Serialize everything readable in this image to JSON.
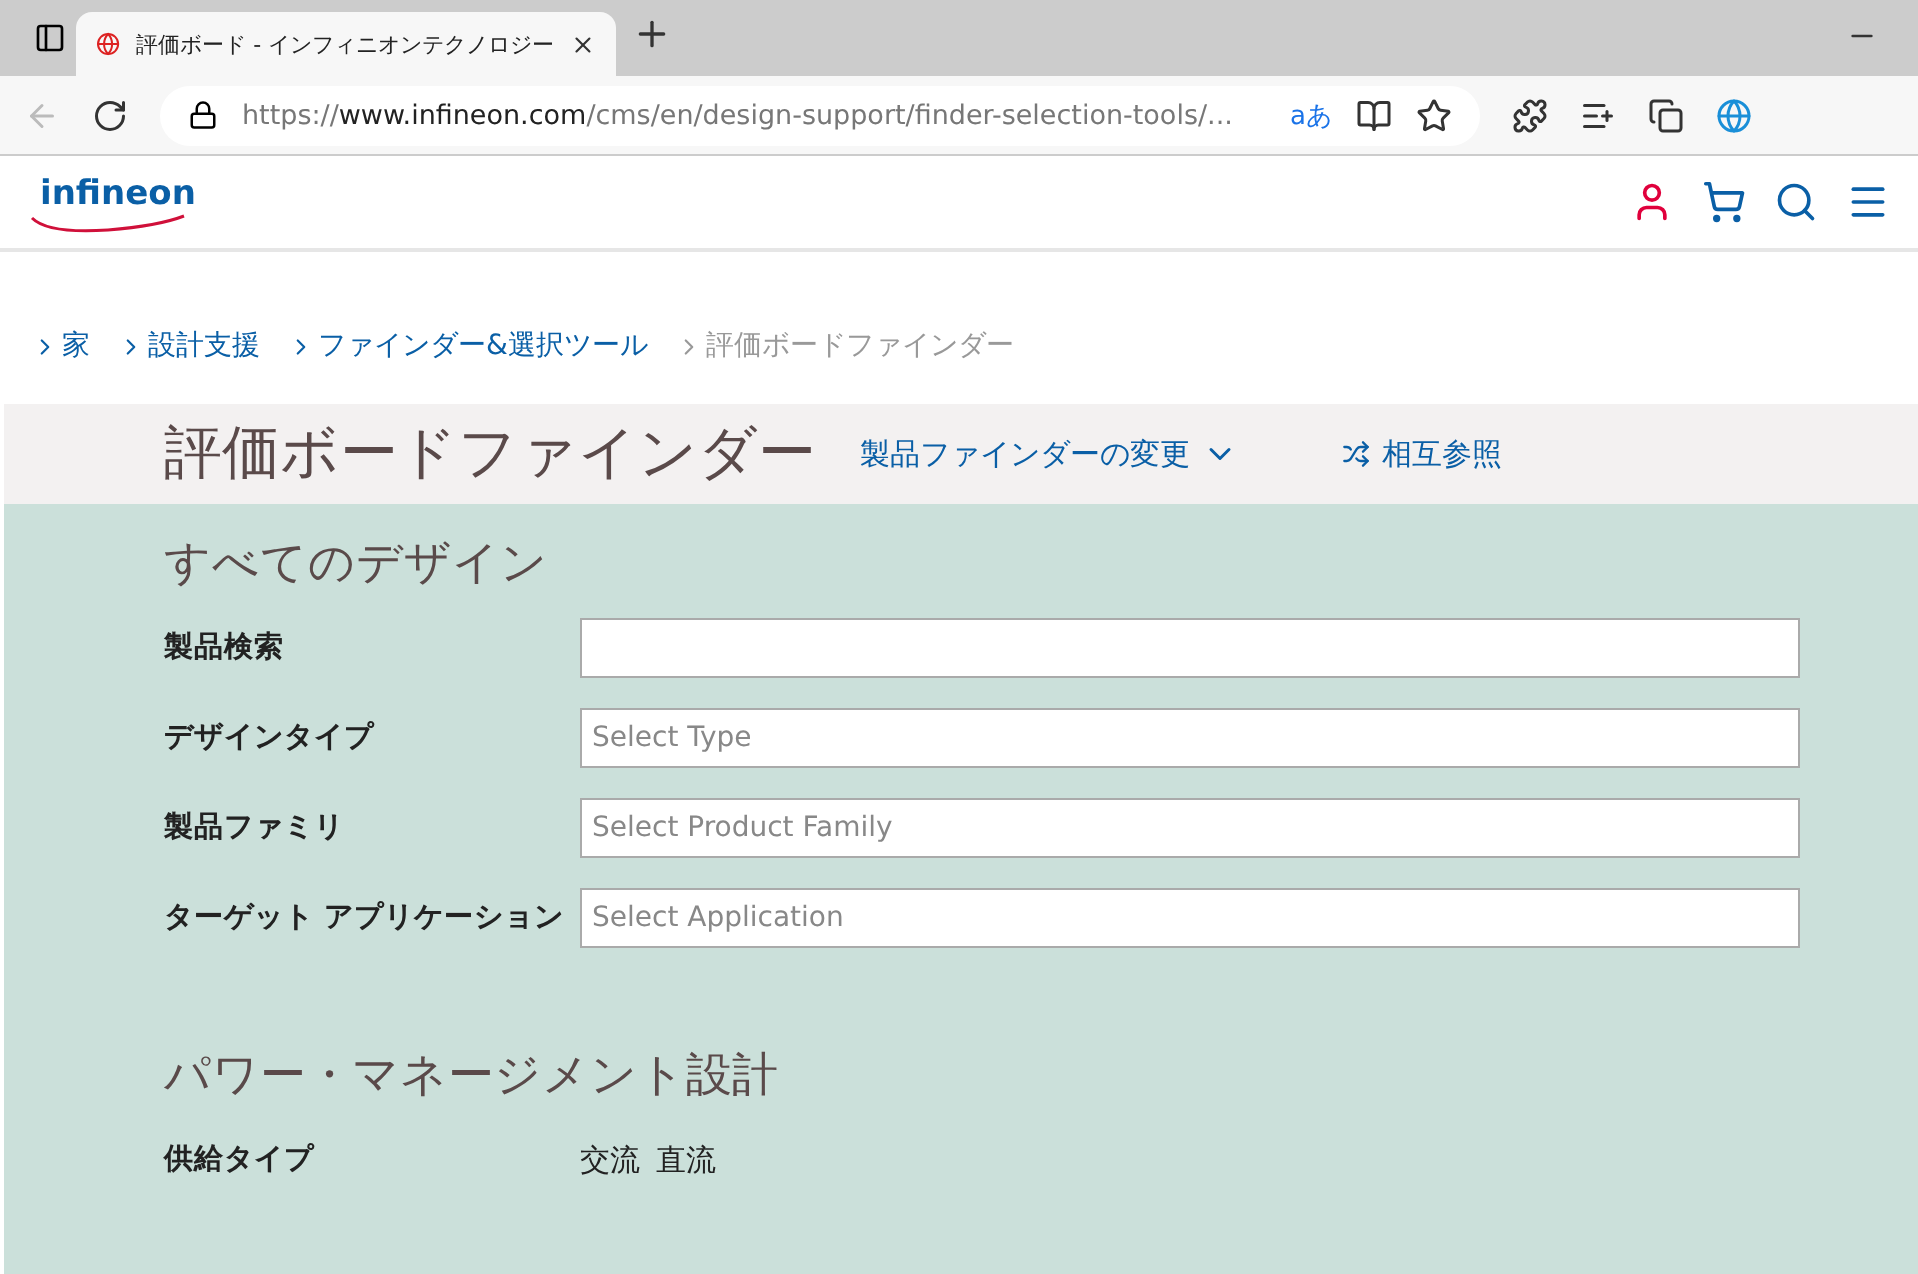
{
  "browser": {
    "tab_title": "評価ボード - インフィニオンテクノロジー",
    "url_scheme": "https://",
    "url_host": "www.infineon.com",
    "url_path": "/cms/en/design-support/finder-selection-tools/...",
    "translate_label": "aあ"
  },
  "site": {
    "logo": "infineon"
  },
  "breadcrumbs": [
    {
      "label": "家",
      "current": false
    },
    {
      "label": "設計支援",
      "current": false
    },
    {
      "label": "ファインダー&選択ツール",
      "current": false
    },
    {
      "label": "評価ボードファインダー",
      "current": true
    }
  ],
  "page_title": "評価ボードファインダー",
  "change_finder": "製品ファインダーの変更",
  "cross_reference": "相互参照",
  "sections": [
    {
      "title": "すべてのデザイン",
      "fields": [
        {
          "kind": "input",
          "label": "製品検索"
        },
        {
          "kind": "select",
          "label": "デザインタイプ",
          "placeholder": "Select Type"
        },
        {
          "kind": "select",
          "label": "製品ファミリ",
          "placeholder": "Select Product Family"
        },
        {
          "kind": "select",
          "label": "ターゲット アプリケーション",
          "placeholder": "Select Application"
        }
      ]
    },
    {
      "title": "パワー・マネージメント設計",
      "fields": [
        {
          "kind": "options",
          "label": "供給タイプ",
          "options": [
            "交流",
            "直流"
          ]
        }
      ]
    }
  ]
}
